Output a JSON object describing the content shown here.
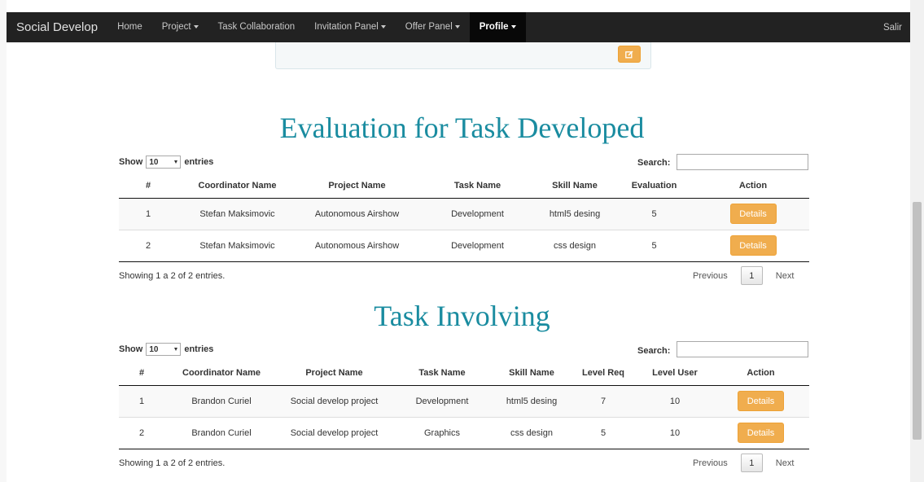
{
  "navbar": {
    "brand": "Social Develop",
    "items": [
      {
        "label": "Home",
        "caret": false,
        "active": false
      },
      {
        "label": "Project",
        "caret": true,
        "active": false
      },
      {
        "label": "Task Collaboration",
        "caret": false,
        "active": false
      },
      {
        "label": "Invitation Panel",
        "caret": true,
        "active": false
      },
      {
        "label": "Offer Panel",
        "caret": true,
        "active": false
      },
      {
        "label": "Profile",
        "caret": true,
        "active": true
      }
    ],
    "right_link": "Salir"
  },
  "icons": {
    "edit": "edit-icon",
    "dropdown": "caret-down-icon"
  },
  "colors": {
    "accent_title": "#1a8ca0",
    "warning_button": "#f0ad4e",
    "navbar_bg": "#222222"
  },
  "evaluation_table": {
    "title": "Evaluation for Task Developed",
    "show_label": "Show",
    "entries_label": "entries",
    "page_length": "10",
    "search_label": "Search:",
    "search_value": "",
    "columns": [
      "#",
      "Coordinator Name",
      "Project Name",
      "Task Name",
      "Skill Name",
      "Evaluation",
      "Action"
    ],
    "rows": [
      {
        "num": "1",
        "coordinator": "Stefan Maksimovic",
        "project": "Autonomous Airshow",
        "task": "Development",
        "skill": "html5 desing",
        "evaluation": "5",
        "action": "Details"
      },
      {
        "num": "2",
        "coordinator": "Stefan Maksimovic",
        "project": "Autonomous Airshow",
        "task": "Development",
        "skill": "css design",
        "evaluation": "5",
        "action": "Details"
      }
    ],
    "info": "Showing 1 a 2 of 2 entries.",
    "previous": "Previous",
    "page": "1",
    "next": "Next"
  },
  "involving_table": {
    "title": "Task Involving",
    "show_label": "Show",
    "entries_label": "entries",
    "page_length": "10",
    "search_label": "Search:",
    "search_value": "",
    "columns": [
      "#",
      "Coordinator Name",
      "Project Name",
      "Task Name",
      "Skill Name",
      "Level Req",
      "Level User",
      "Action"
    ],
    "rows": [
      {
        "num": "1",
        "coordinator": "Brandon Curiel",
        "project": "Social develop project",
        "task": "Development",
        "skill": "html5 desing",
        "level_req": "7",
        "level_user": "10",
        "action": "Details"
      },
      {
        "num": "2",
        "coordinator": "Brandon Curiel",
        "project": "Social develop project",
        "task": "Graphics",
        "skill": "css design",
        "level_req": "5",
        "level_user": "10",
        "action": "Details"
      }
    ],
    "info": "Showing 1 a 2 of 2 entries.",
    "previous": "Previous",
    "page": "1",
    "next": "Next"
  }
}
